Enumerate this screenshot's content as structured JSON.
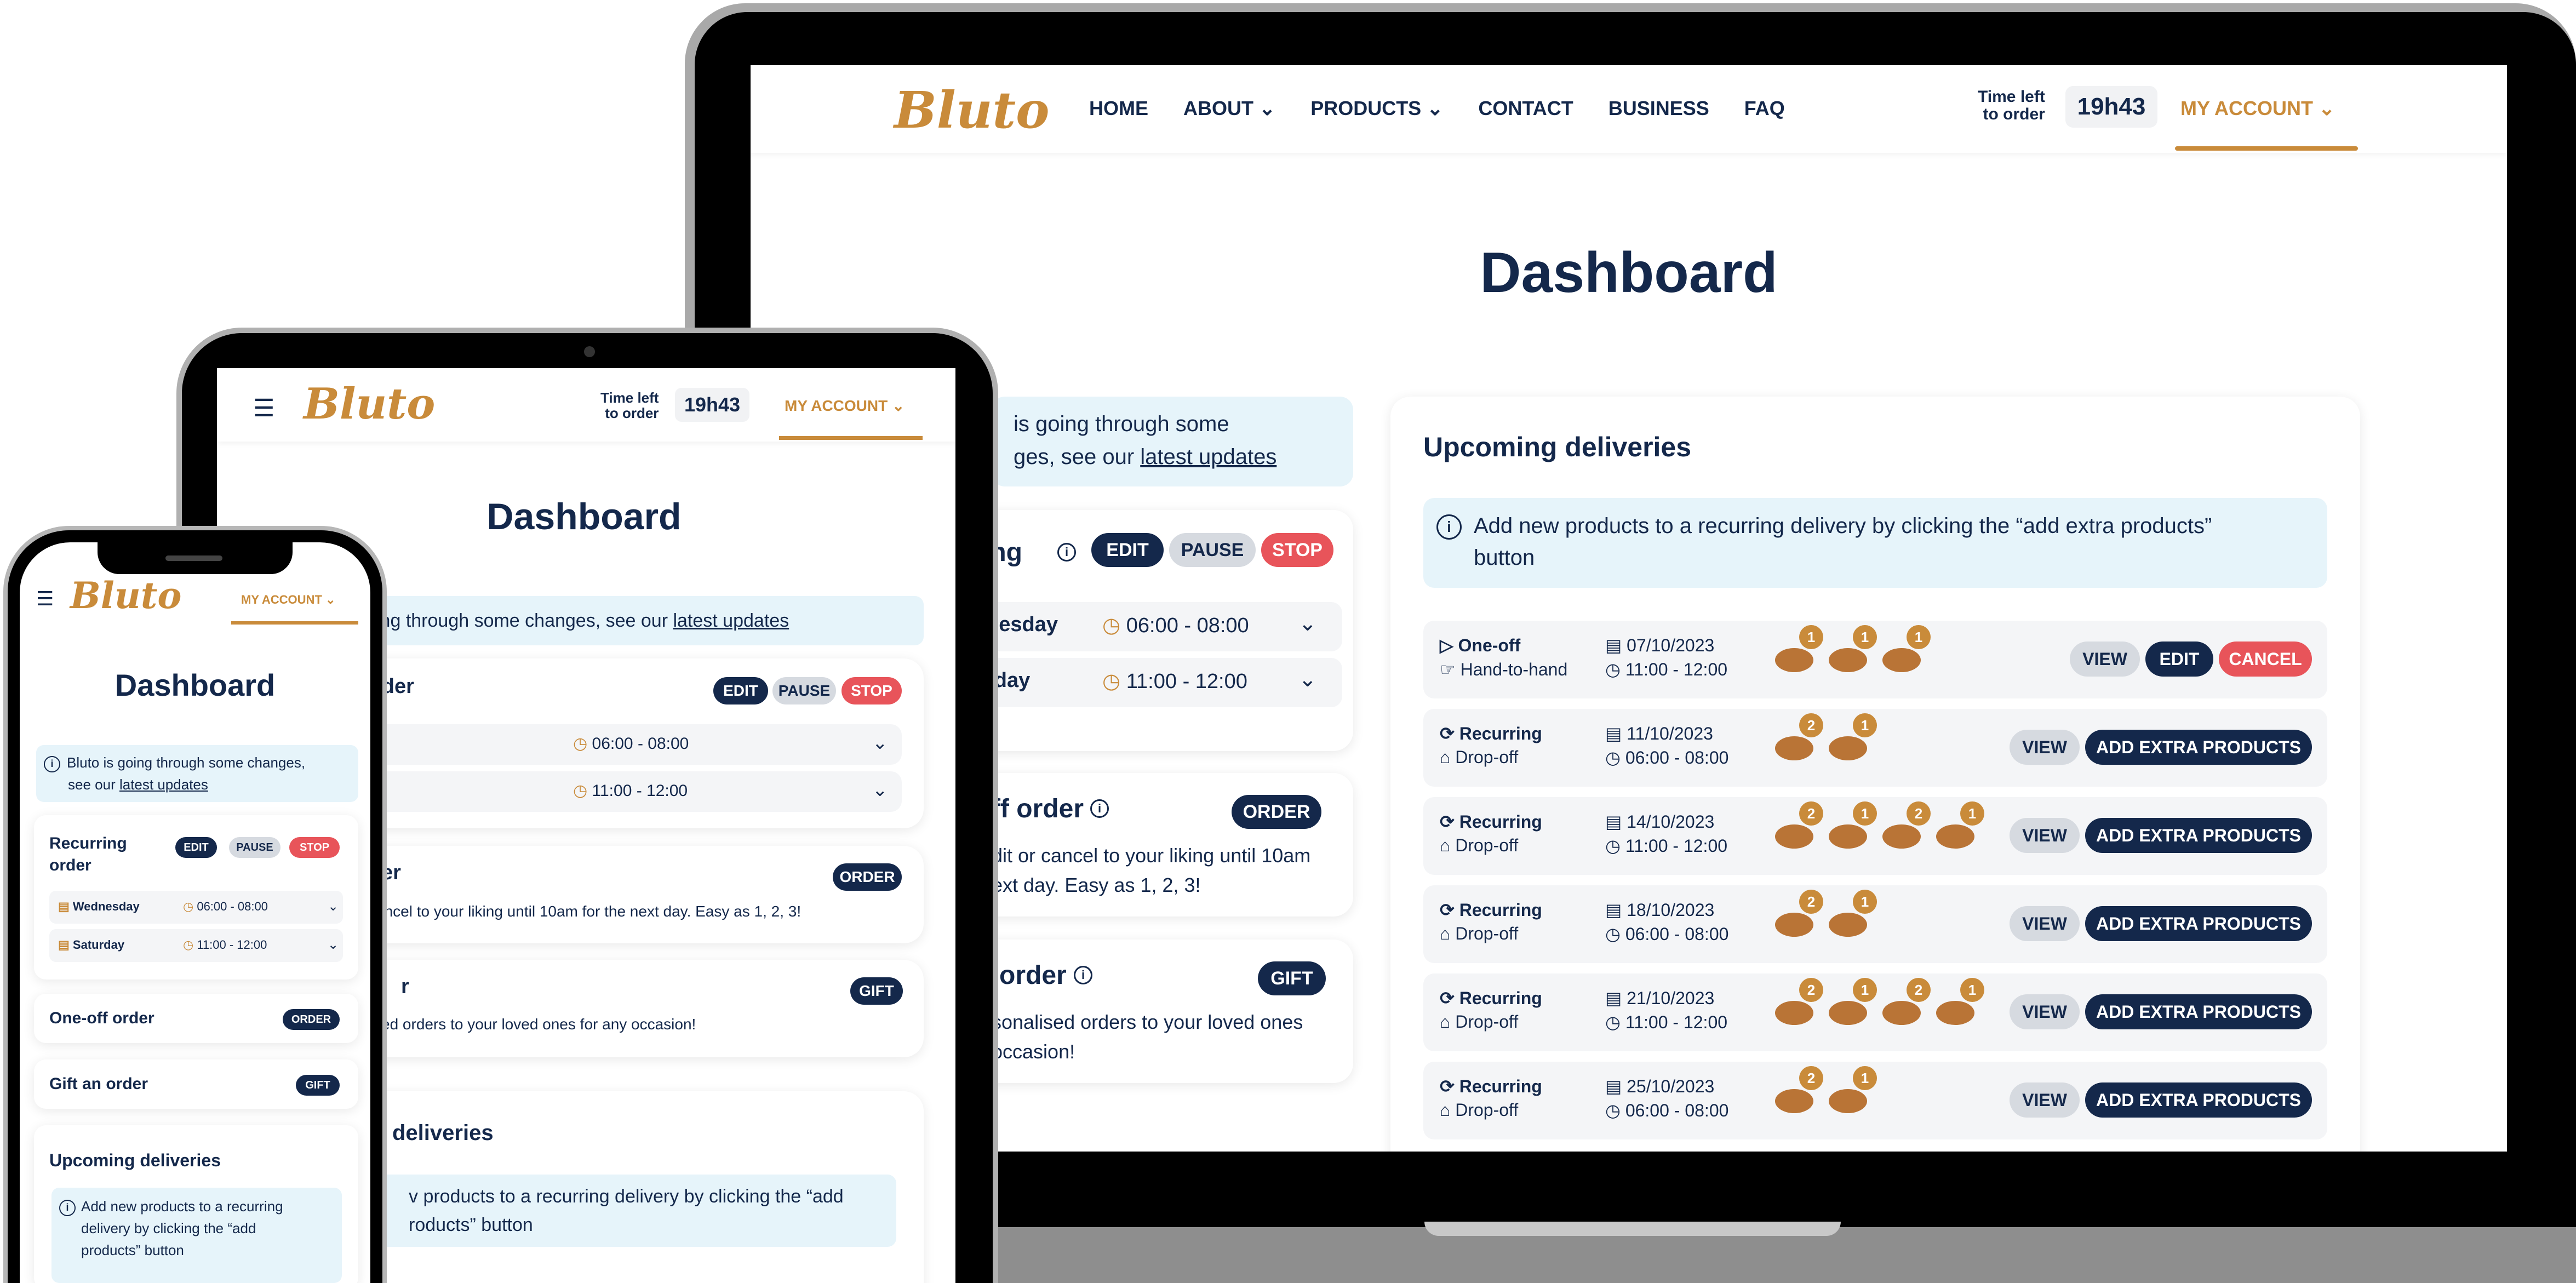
{
  "brand": {
    "logo": "Bluto"
  },
  "nav": {
    "home": "HOME",
    "about": "ABOUT",
    "products": "PRODUCTS",
    "contact": "CONTACT",
    "business": "BUSINESS",
    "faq": "FAQ"
  },
  "timer": {
    "label_line1": "Time left",
    "label_line2": "to order",
    "value": "19h43"
  },
  "account": {
    "label": "MY ACCOUNT"
  },
  "page_title": "Dashboard",
  "notice": {
    "laptop_part1": "is going through some",
    "laptop_part2_prefix": "ges, see our",
    "link": "latest updates",
    "tablet": "ing through some changes, see our",
    "phone_line1": "Bluto is going through some changes,",
    "phone_line2_prefix": "see our"
  },
  "recurring": {
    "title_laptop": "ing",
    "title_tablet": "rder",
    "title_phone": "Recurring order",
    "edit": "EDIT",
    "pause": "PAUSE",
    "stop": "STOP",
    "days": [
      {
        "day": "Wednesday",
        "laptop": "nesday",
        "time": "06:00 - 08:00"
      },
      {
        "day": "Saturday",
        "laptop": "rday",
        "time": "11:00 - 12:00"
      }
    ]
  },
  "oneoff": {
    "title_laptop": "ff order",
    "title_tablet": "er",
    "title_phone": "One-off order",
    "button": "ORDER",
    "text_laptop1": "dit or cancel to your liking until 10am",
    "text_laptop2": "ext day. Easy as 1, 2, 3!",
    "text_tablet": "ancel to your liking until 10am for the next day. Easy as 1, 2, 3!"
  },
  "gift": {
    "title_laptop": "order",
    "title_tablet": "r",
    "title_phone": "Gift an order",
    "button": "GIFT",
    "text_laptop1": "sonalised orders to your loved ones",
    "text_laptop2": "occasion!",
    "text_tablet": "ed orders to your loved ones for any occasion!"
  },
  "upcoming": {
    "title": "Upcoming deliveries",
    "tablet_title": "deliveries",
    "info_line1": "Add new products to a recurring delivery by clicking the “add extra products”",
    "info_line2": "button",
    "tablet_info1": "v products to a recurring delivery by clicking the “add",
    "tablet_info2": "roducts” button",
    "phone_info1": "Add new products to a recurring",
    "phone_info2": "delivery by clicking the “add",
    "phone_info3": "products” button",
    "view": "VIEW",
    "edit": "EDIT",
    "cancel": "CANCEL",
    "add": "ADD EXTRA PRODUCTS",
    "rows": [
      {
        "type": "One-off",
        "method": "Hand-to-hand",
        "date": "07/10/2023",
        "time": "11:00 - 12:00",
        "badges": [
          "1",
          "1",
          "1"
        ]
      },
      {
        "type": "Recurring",
        "method": "Drop-off",
        "date": "11/10/2023",
        "time": "06:00 - 08:00",
        "badges": [
          "2",
          "1"
        ]
      },
      {
        "type": "Recurring",
        "method": "Drop-off",
        "date": "14/10/2023",
        "time": "11:00 - 12:00",
        "badges": [
          "2",
          "1",
          "2",
          "1"
        ]
      },
      {
        "type": "Recurring",
        "method": "Drop-off",
        "date": "18/10/2023",
        "time": "06:00 - 08:00",
        "badges": [
          "2",
          "1"
        ]
      },
      {
        "type": "Recurring",
        "method": "Drop-off",
        "date": "21/10/2023",
        "time": "11:00 - 12:00",
        "badges": [
          "2",
          "1",
          "2",
          "1"
        ]
      },
      {
        "type": "Recurring",
        "method": "Drop-off",
        "date": "25/10/2023",
        "time": "06:00 - 08:00",
        "badges": [
          "2",
          "1"
        ]
      }
    ]
  },
  "icons": {
    "menu": "hamburger-icon",
    "info": "info-icon",
    "chevron": "chevron-down-icon",
    "calendar": "calendar-icon",
    "clock": "clock-icon",
    "recurring": "refresh-icon",
    "oneoff": "play-icon",
    "home": "home-icon",
    "hand": "hand-icon"
  },
  "colors": {
    "navy": "#14284b",
    "gold": "#c98b3a",
    "red": "#e8545a",
    "info_bg": "#e6f4fa"
  }
}
